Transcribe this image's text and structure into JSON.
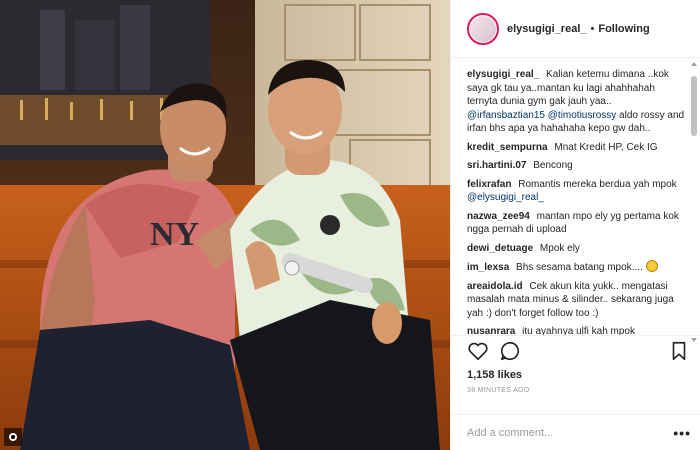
{
  "post": {
    "author": "elysugigi_real_",
    "separator": "•",
    "follow_status": "Following",
    "likes": "1,158 likes",
    "timestamp": "38 MINUTES AGO",
    "add_comment_placeholder": "Add a comment...",
    "more_label": "•••"
  },
  "caption": {
    "user": "elysugigi_real_",
    "text_1": "Kalian ketemu dimana ..kok saya gk tau ya..mantan ku lagi ahahhahah ternyta dunia gym gak jauh yaa..",
    "mention_1": "@irfansbaztian15",
    "mention_2": "@timotiusrossy",
    "text_2": "aldo rossy and irfan bhs apa ya hahahaha kepo gw dah.."
  },
  "comments": [
    {
      "user": "kredit_sempurna",
      "text": "Mnat Kredit HP, Cek IG"
    },
    {
      "user": "sri.hartini.07",
      "text": "Bencong"
    },
    {
      "user": "felixrafan",
      "text": "Romantis mereka berdua yah mpok",
      "mention": "@elysugigi_real_"
    },
    {
      "user": "nazwa_zee94",
      "text": "mantan mpo ely yg pertama kok ngga pernah di upload"
    },
    {
      "user": "dewi_detuage",
      "text": "Mpok ely"
    },
    {
      "user": "im_lexsa",
      "text": "Bhs sesama batang mpok...."
    },
    {
      "user": "areaidola.id",
      "text": "Cek akun kita yukk.. mengatasi masalah mata minus & silinder.. sekarang juga yah :) don't forget follow too :)"
    },
    {
      "user": "nusanrara",
      "text": "itu ayahnya ulfi kah mpok"
    }
  ],
  "icons": {
    "like": "heart-icon",
    "comment": "comment-bubble-icon",
    "save": "bookmark-icon",
    "type": "video-icon"
  },
  "colors": {
    "avatar_ring": "#e3175d",
    "mention": "#003569",
    "muted": "#999999"
  }
}
